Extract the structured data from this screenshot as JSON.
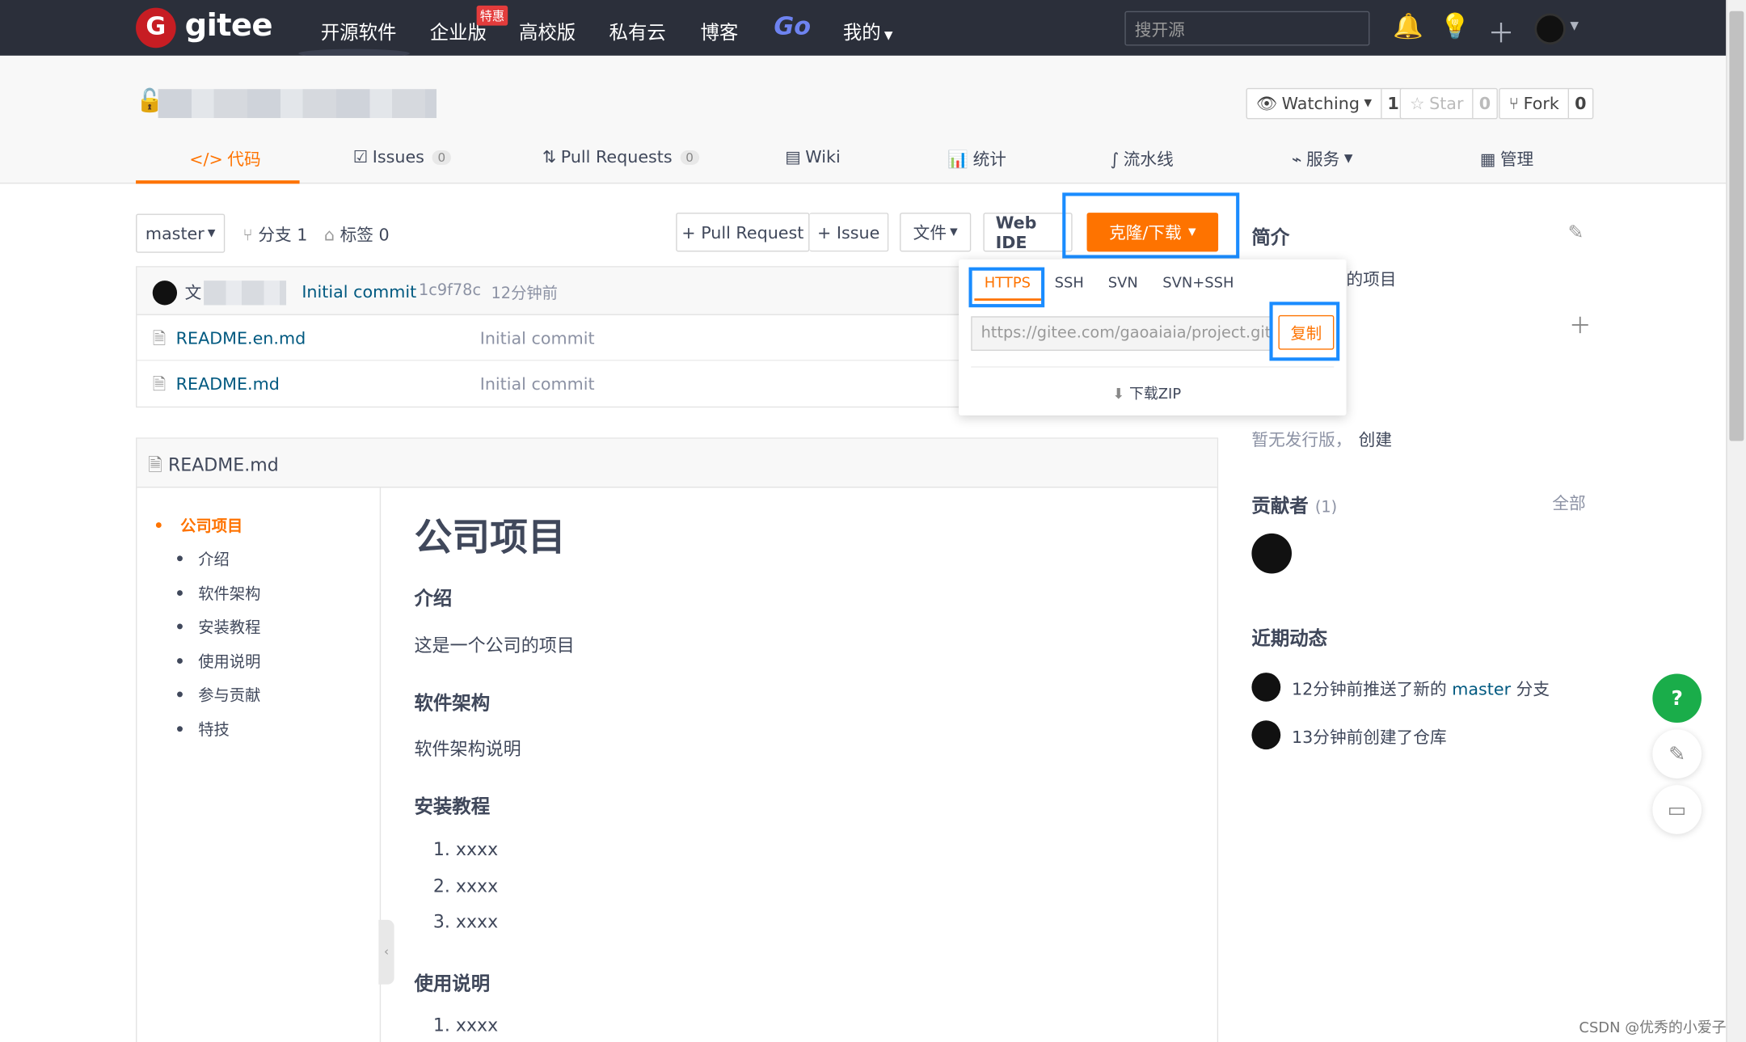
{
  "topbar": {
    "logo_mark": "G",
    "logo_text": "gitee",
    "nav": [
      "开源软件",
      "企业版",
      "高校版",
      "私有云",
      "博客",
      "Go",
      "我的"
    ],
    "enterprise_badge": "特惠",
    "search_placeholder": "搜开源"
  },
  "project": {
    "watch_label": "Watching",
    "watch_count": "1",
    "star_label": "Star",
    "star_count": "0",
    "fork_label": "Fork",
    "fork_count": "0",
    "tabs": [
      {
        "label": "代码",
        "icon": "</>"
      },
      {
        "label": "Issues",
        "count": "0"
      },
      {
        "label": "Pull Requests",
        "count": "0"
      },
      {
        "label": "Wiki"
      },
      {
        "label": "统计"
      },
      {
        "label": "流水线"
      },
      {
        "label": "服务"
      },
      {
        "label": "管理"
      }
    ]
  },
  "toolbar": {
    "branch": "master",
    "branches": "分支 1",
    "tags": "标签 0",
    "pull_request": "+ Pull Request",
    "issue": "+ Issue",
    "file": "文件",
    "web_ide": "Web IDE",
    "clone": "克隆/下载"
  },
  "commit": {
    "author_visible": "文",
    "message": "Initial commit",
    "hash": "1c9f78c",
    "time": "12分钟前"
  },
  "files": [
    {
      "name": "README.en.md",
      "commit": "Initial commit"
    },
    {
      "name": "README.md",
      "commit": "Initial commit"
    }
  ],
  "clone_dropdown": {
    "protocols": [
      "HTTPS",
      "SSH",
      "SVN",
      "SVN+SSH"
    ],
    "active": "HTTPS",
    "url": "https://gitee.com/gaoaiaia/project.git",
    "copy": "复制",
    "download_zip": "下载ZIP"
  },
  "readme": {
    "filename": "README.md",
    "toc": [
      "公司项目",
      "介绍",
      "软件架构",
      "安装教程",
      "使用说明",
      "参与贡献",
      "特技"
    ],
    "h1": "公司项目",
    "intro_h": "介绍",
    "intro_p": "这是一个公司的项目",
    "arch_h": "软件架构",
    "arch_p": "软件架构说明",
    "install_h": "安装教程",
    "install_list": [
      "xxxx",
      "xxxx",
      "xxxx"
    ],
    "usage_h": "使用说明",
    "usage_list": [
      "xxxx"
    ]
  },
  "sidebar": {
    "intro_title": "简介",
    "intro_partial": "的项目",
    "no_release": "暂无发行版，",
    "create": "创建",
    "contributors_title": "贡献者",
    "contributors_count": "(1)",
    "all": "全部",
    "activity_title": "近期动态",
    "activity": [
      {
        "prefix": "12分钟前推送了新的 ",
        "link": "master",
        "suffix": " 分支"
      },
      {
        "prefix": "13分钟前创建了仓库",
        "link": "",
        "suffix": ""
      }
    ]
  },
  "watermark": "CSDN @优秀的小爱子",
  "colors": {
    "accent": "#fe7300",
    "topbar": "#2b2f3a",
    "highlight": "#1a8cff",
    "link": "#005980"
  }
}
